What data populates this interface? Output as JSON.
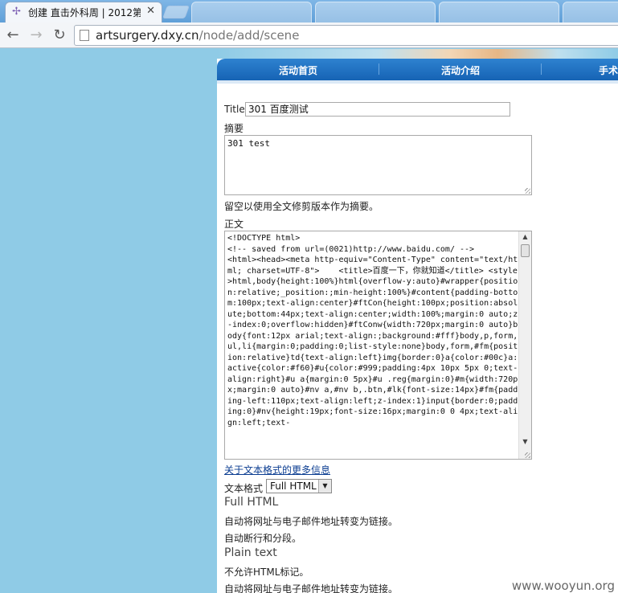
{
  "browser": {
    "tab_title": "创建 直击外科周 | 2012第",
    "url_domain": "artsurgery.dxy.cn",
    "url_path": "/node/add/scene"
  },
  "site_nav": {
    "items": [
      "活动首页",
      "活动介绍",
      "手术"
    ]
  },
  "form": {
    "title_label": "Title",
    "title_value": "301 百度测试",
    "summary_label": "摘要",
    "summary_value": "301 test",
    "summary_help": "留空以使用全文修剪版本作为摘要。",
    "body_label": "正文",
    "body_value": "<!DOCTYPE html>\n<!-- saved from url=(0021)http://www.baidu.com/ -->\n<html><head><meta http-equiv=\"Content-Type\" content=\"text/html; charset=UTF-8\">    <title>百度一下，你就知道</title> <style>html,body{height:100%}html{overflow-y:auto}#wrapper{position:relative;_position:;min-height:100%}#content{padding-bottom:100px;text-align:center}#ftCon{height:100px;position:absolute;bottom:44px;text-align:center;width:100%;margin:0 auto;z-index:0;overflow:hidden}#ftConw{width:720px;margin:0 auto}body{font:12px arial;text-align:;background:#fff}body,p,form,ul,li{margin:0;padding:0;list-style:none}body,form,#fm{position:relative}td{text-align:left}img{border:0}a{color:#00c}a:active{color:#f60}#u{color:#999;padding:4px 10px 5px 0;text-align:right}#u a{margin:0 5px}#u .reg{margin:0}#m{width:720px;margin:0 auto}#nv a,#nv b,.btn,#lk{font-size:14px}#fm{padding-left:110px;text-align:left;z-index:1}input{border:0;padding:0}#nv{height:19px;font-size:16px;margin:0 0 4px;text-align:left;text-",
    "format_help_link": "关于文本格式的更多信息",
    "format_label": "文本格式",
    "format_selected": "Full HTML",
    "formats": [
      {
        "name": "Full HTML",
        "notes": [
          "自动将网址与电子邮件地址转变为链接。",
          "自动断行和分段。"
        ]
      },
      {
        "name": "Plain text",
        "notes": [
          "不允许HTML标记。",
          "自动将网址与电子邮件地址转变为链接。"
        ]
      }
    ]
  },
  "watermark": "www.wooyun.org"
}
